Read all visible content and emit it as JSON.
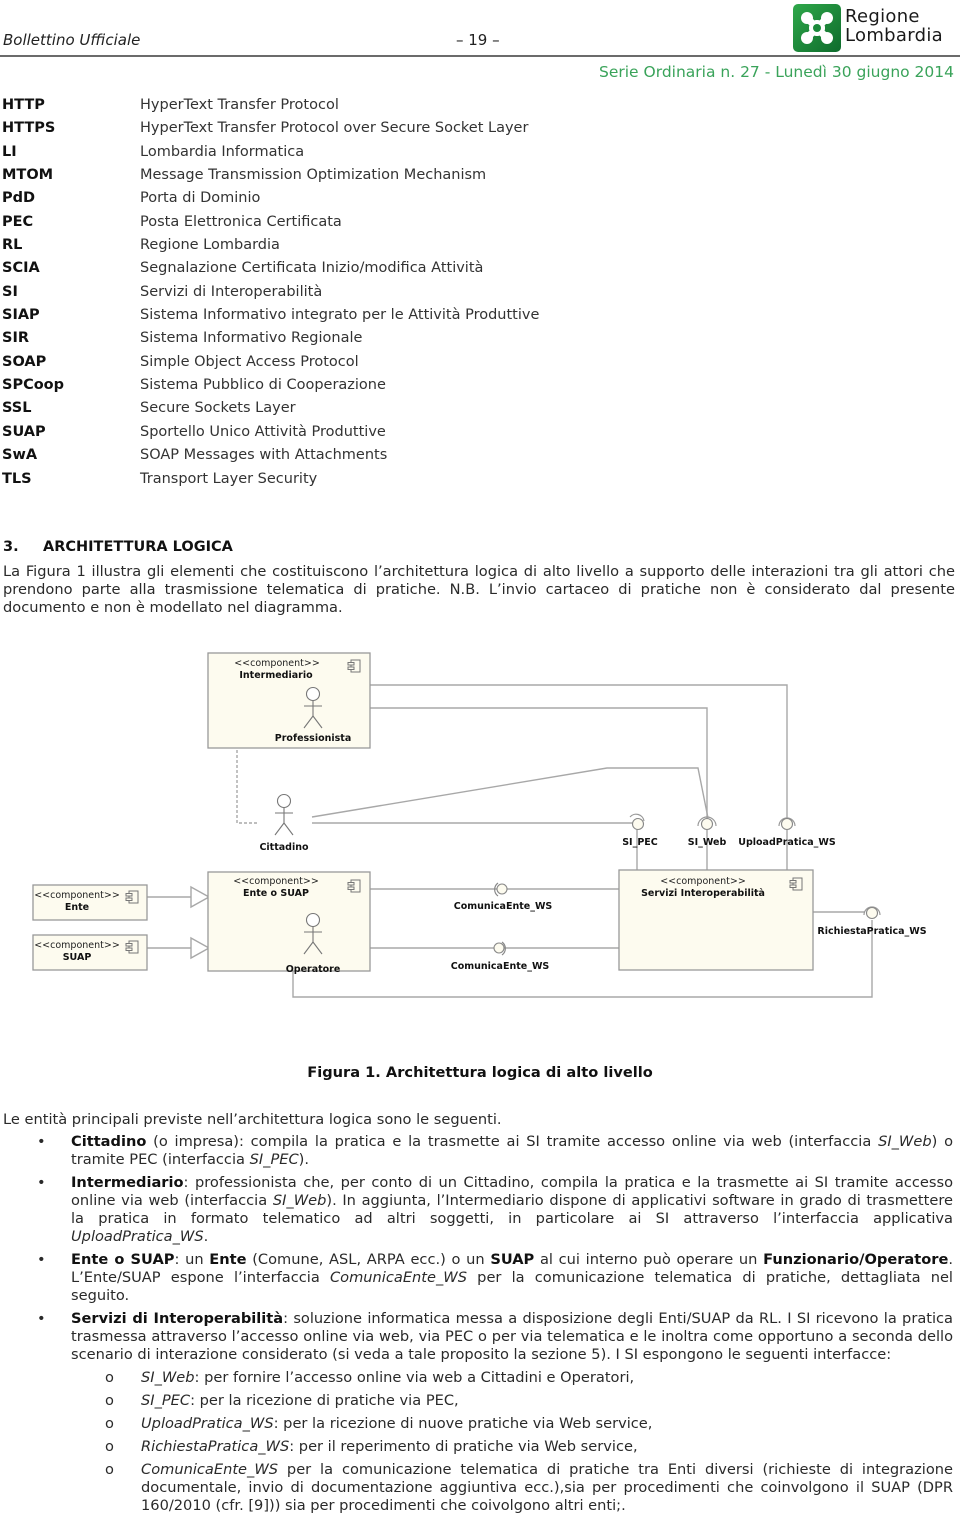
{
  "header": {
    "publication": "Bollettino Ufficiale",
    "page_number": "– 19 –",
    "series": "Serie Ordinaria n. 27 - Lunedì 30 giugno 2014",
    "logo_line1": "Regione",
    "logo_line2": "Lombardia",
    "logo_icon": "lombardy-rose-icon",
    "brand_color": "#1f8a3c"
  },
  "abbreviations": [
    {
      "key": "HTTP",
      "value": "HyperText Transfer Protocol"
    },
    {
      "key": "HTTPS",
      "value": "HyperText Transfer Protocol over Secure Socket Layer"
    },
    {
      "key": "LI",
      "value": "Lombardia Informatica"
    },
    {
      "key": "MTOM",
      "value": "Message Transmission Optimization Mechanism"
    },
    {
      "key": "PdD",
      "value": "Porta di Dominio"
    },
    {
      "key": "PEC",
      "value": "Posta Elettronica Certificata"
    },
    {
      "key": "RL",
      "value": "Regione Lombardia"
    },
    {
      "key": "SCIA",
      "value": "Segnalazione Certificata Inizio/modifica Attività"
    },
    {
      "key": "SI",
      "value": "Servizi di Interoperabilità"
    },
    {
      "key": "SIAP",
      "value": "Sistema Informativo integrato per le Attività Produttive"
    },
    {
      "key": "SIR",
      "value": "Sistema Informativo Regionale"
    },
    {
      "key": "SOAP",
      "value": "Simple Object Access Protocol"
    },
    {
      "key": "SPCoop",
      "value": "Sistema Pubblico di Cooperazione"
    },
    {
      "key": "SSL",
      "value": "Secure Sockets Layer"
    },
    {
      "key": "SUAP",
      "value": "Sportello Unico Attività Produttive"
    },
    {
      "key": "SwA",
      "value": "SOAP Messages with Attachments"
    },
    {
      "key": "TLS",
      "value": "Transport Layer Security"
    }
  ],
  "section": {
    "number": "3.",
    "title": "ARCHITETTURA LOGICA",
    "intro": "La Figura 1 illustra gli elementi che costituiscono l’architettura logica di alto livello a supporto delle interazioni tra gli attori che prendono parte alla trasmissione telematica di pratiche. N.B. L’invio cartaceo di pratiche non è considerato dal presente documento e non è modellato nel diagramma."
  },
  "diagram": {
    "stereotype": "<<component>>",
    "components": {
      "intermediario": "Intermediario",
      "ente": "Ente",
      "suap": "SUAP",
      "ente_o_suap": "Ente o SUAP",
      "servizi": "Servizi Interoperabilità"
    },
    "actors": {
      "professionista": "Professionista",
      "cittadino": "Cittadino",
      "operatore": "Operatore"
    },
    "interfaces": {
      "si_pec": "SI_PEC",
      "si_web": "SI_Web",
      "upload": "UploadPratica_WS",
      "comunica1": "ComunicaEnte_WS",
      "comunica2": "ComunicaEnte_WS",
      "richiesta": "RichiestaPratica_WS"
    }
  },
  "caption": "Figura 1. Architettura logica di alto livello",
  "entities_intro": "Le entità principali previste nell’architettura logica sono le seguenti.",
  "bullets": {
    "cittadino": {
      "term": "Cittadino",
      "t1": " (o impresa): compila la pratica e la trasmette ai SI tramite accesso online via web (interfaccia ",
      "i1": "SI_Web",
      "t2": ") o tramite PEC (interfaccia ",
      "i2": "SI_PEC",
      "t3": ")."
    },
    "intermediario": {
      "term": "Intermediario",
      "t1": ": professionista che, per conto di un Cittadino, compila la pratica e la trasmette ai SI tramite accesso online via web (interfaccia ",
      "i1": "SI_Web",
      "t2": "). In aggiunta, l’Intermediario dispone di applicativi software in grado di trasmettere la pratica in formato telematico ad altri soggetti, in particolare ai SI attraverso l’interfaccia applicativa ",
      "i2": "UploadPratica_WS",
      "t3": "."
    },
    "ente": {
      "term": "Ente o SUAP",
      "t1": ": un ",
      "b1": "Ente",
      "t2": " (Comune, ASL, ARPA ecc.) o un ",
      "b2": "SUAP",
      "t3": " al cui interno può operare un ",
      "b3": "Funzionario/Operatore",
      "t4": ". L’Ente/SUAP espone l’interfaccia ",
      "i1": "ComunicaEnte_WS",
      "t5": " per la comunicazione telematica di pratiche, dettagliata nel seguito."
    },
    "servizi": {
      "term": "Servizi di Interoperabilità",
      "t1": ": soluzione informatica messa a disposizione degli Enti/SUAP da RL. I SI ricevono la pratica trasmessa attraverso l’accesso online via web, via PEC o per via telematica e le inoltra come opportuno a seconda dello scenario di interazione considerato (si veda a tale proposito la sezione 5). I SI espongono le seguenti interfacce:"
    },
    "sub": [
      {
        "name": "SI_Web",
        "text": ": per fornire l’accesso online via web a Cittadini e Operatori,"
      },
      {
        "name": "SI_PEC",
        "text": ": per la ricezione di pratiche via PEC,"
      },
      {
        "name": "UploadPratica_WS",
        "text": ": per la ricezione di nuove pratiche via Web service,"
      },
      {
        "name": "RichiestaPratica_WS",
        "text": ": per il reperimento di pratiche via Web service,"
      },
      {
        "name": "ComunicaEnte_WS",
        "text": " per la comunicazione telematica di pratiche tra Enti diversi (richieste di integrazione documentale, invio di documentazione aggiuntiva ecc.),sia per procedimenti che coinvolgono il SUAP (DPR 160/2010 (cfr. [9])) sia per procedimenti che coivolgono altri enti;."
      }
    ],
    "bullet_glyph": "•",
    "sub_glyph": "o"
  }
}
